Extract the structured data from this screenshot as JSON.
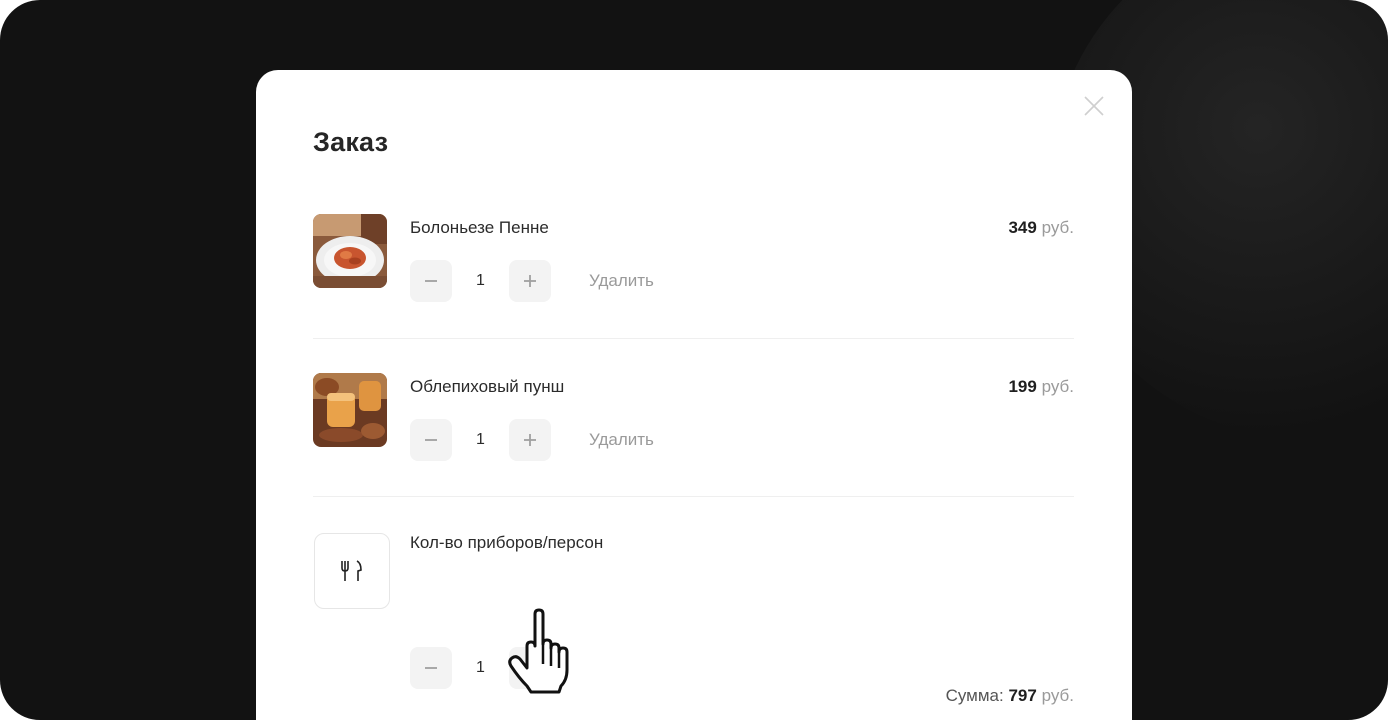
{
  "modal": {
    "title": "Заказ",
    "close_icon": "close-icon"
  },
  "items": [
    {
      "name": "Болоньезе Пенне",
      "price": "349",
      "currency": "руб.",
      "quantity": "1",
      "remove_label": "Удалить"
    },
    {
      "name": "Облепиховый пунш",
      "price": "199",
      "currency": "руб.",
      "quantity": "1",
      "remove_label": "Удалить"
    }
  ],
  "cutlery": {
    "label": "Кол-во приборов/персон",
    "quantity": "1",
    "icon": "cutlery-icon"
  },
  "total": {
    "label": "Сумма:",
    "amount": "797",
    "currency": "руб."
  },
  "colors": {
    "background": "#121212",
    "modal": "#ffffff",
    "button_bg": "#f3f3f3",
    "muted_text": "#9a9a9a"
  }
}
